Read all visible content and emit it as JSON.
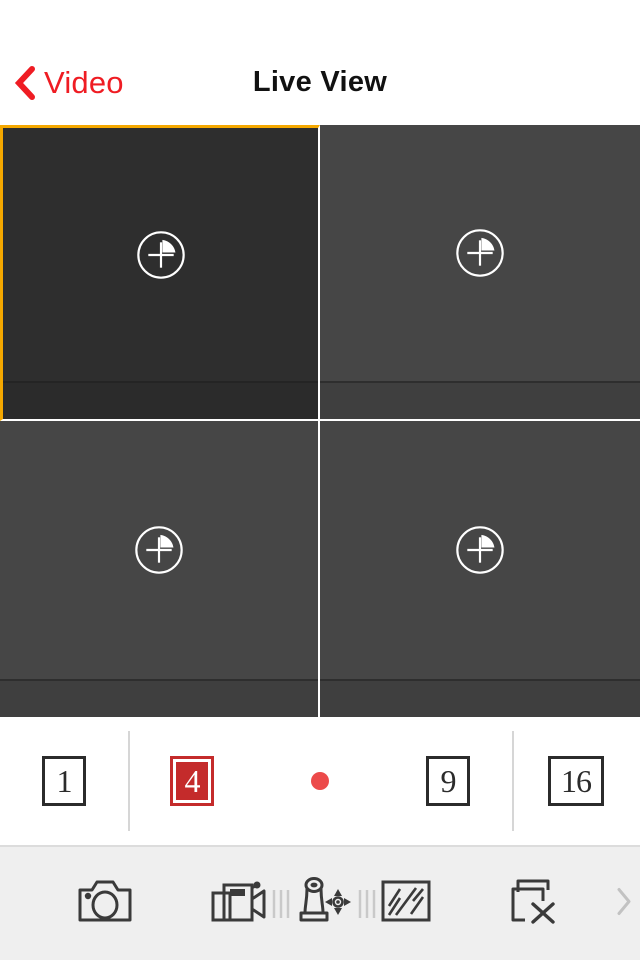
{
  "app": {
    "accent_red": "#ef1c23",
    "selection_orange": "#f5a800",
    "cell_bg": "#464646",
    "cell_bg_selected": "#2e2e2e",
    "toolbar_bg": "#efefef"
  },
  "nav": {
    "back_label": "Video",
    "back_icon": "chevron-left-icon",
    "title": "Live View"
  },
  "grid": {
    "columns": 2,
    "rows": 2,
    "cells": [
      {
        "index": 1,
        "selected": true,
        "placeholder_icon": "add-camera-icon",
        "status": ""
      },
      {
        "index": 2,
        "selected": false,
        "placeholder_icon": "add-camera-icon",
        "status": ""
      },
      {
        "index": 3,
        "selected": false,
        "placeholder_icon": "add-camera-icon",
        "status": ""
      },
      {
        "index": 4,
        "selected": false,
        "placeholder_icon": "add-camera-icon",
        "status": ""
      }
    ]
  },
  "layout_bar": {
    "options": [
      {
        "label": "1",
        "active": false,
        "icon": "layout-1-icon"
      },
      {
        "label": "4",
        "active": true,
        "icon": "layout-4-icon"
      },
      {
        "label": "9",
        "active": false,
        "icon": "layout-9-icon"
      },
      {
        "label": "16",
        "active": false,
        "icon": "layout-16-icon"
      }
    ],
    "record_indicator": {
      "icon": "record-dot-icon",
      "color": "#ec4a4a"
    }
  },
  "toolbar": {
    "items": [
      {
        "name": "snapshot-button",
        "icon": "camera-icon"
      },
      {
        "name": "record-button",
        "icon": "camcorder-icon"
      },
      {
        "name": "ptz-button",
        "icon": "ptz-joystick-icon"
      },
      {
        "name": "image-quality-button",
        "icon": "stripes-square-icon"
      },
      {
        "name": "close-all-button",
        "icon": "close-windows-icon"
      }
    ],
    "more_icon": "chevron-right-icon"
  }
}
